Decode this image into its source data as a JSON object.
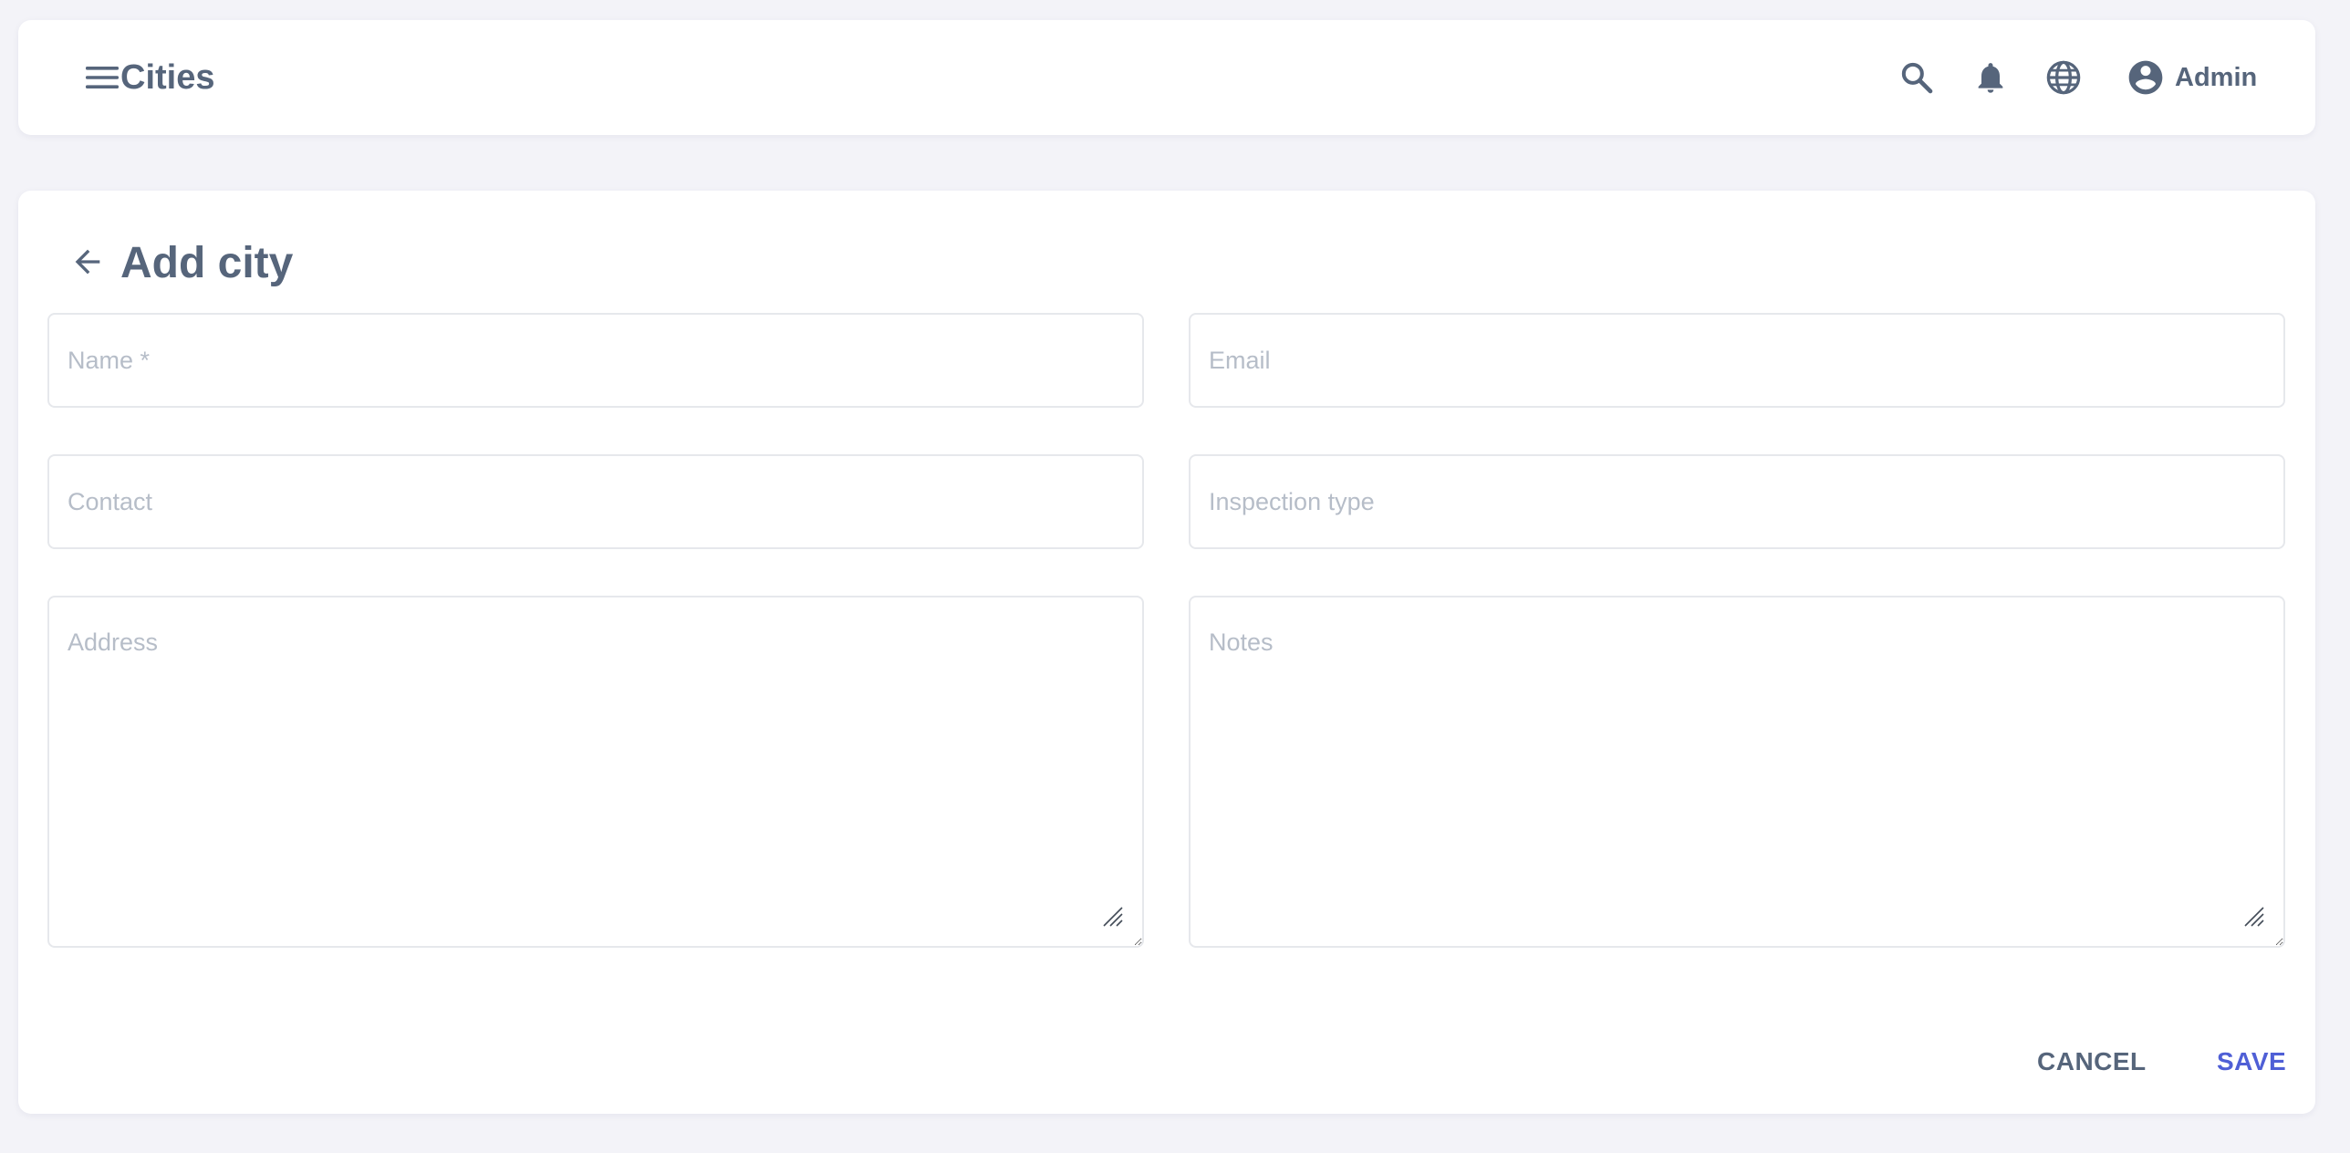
{
  "header": {
    "title": "Cities",
    "menu_icon": "hamburger-menu-icon",
    "search_icon": "search-icon",
    "notifications_icon": "bell-icon",
    "language_icon": "globe-icon",
    "user": {
      "icon": "account-circle-icon",
      "name": "Admin"
    }
  },
  "form": {
    "back_icon": "arrow-left-icon",
    "title": "Add city",
    "fields": {
      "name": {
        "placeholder": "Name *",
        "value": ""
      },
      "email": {
        "placeholder": "Email",
        "value": ""
      },
      "contact": {
        "placeholder": "Contact",
        "value": ""
      },
      "inspection_type": {
        "placeholder": "Inspection type",
        "value": ""
      },
      "address": {
        "placeholder": "Address",
        "value": ""
      },
      "notes": {
        "placeholder": "Notes",
        "value": ""
      }
    },
    "actions": {
      "cancel_label": "CANCEL",
      "save_label": "SAVE"
    }
  },
  "colors": {
    "background": "#f3f3f8",
    "surface": "#ffffff",
    "text": "#56657b",
    "placeholder": "#b6bdc8",
    "border": "#e6e8ec",
    "accent": "#4f5fd6"
  }
}
